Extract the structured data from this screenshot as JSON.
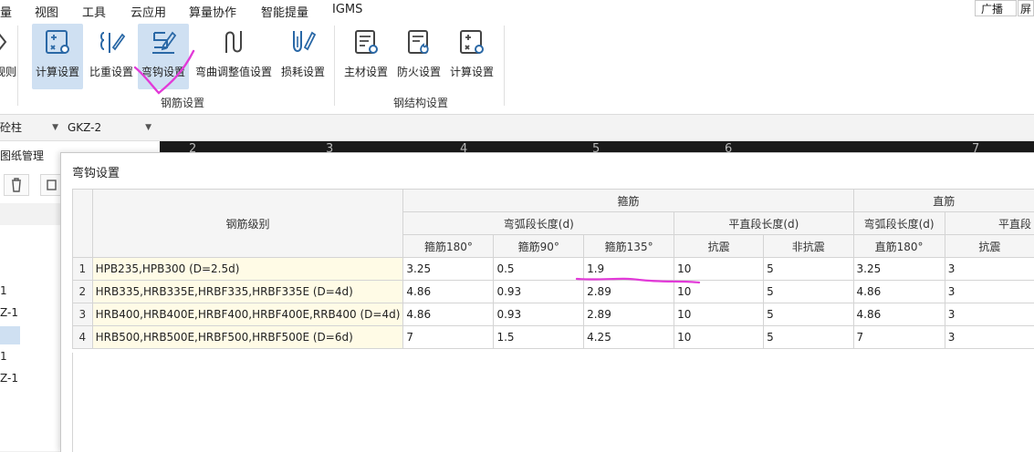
{
  "menubar": {
    "items": [
      "量",
      "视图",
      "工具",
      "云应用",
      "算量协作",
      "智能提量",
      "IGMS"
    ],
    "right_buttons": [
      "广播",
      "屏"
    ]
  },
  "ribbon": {
    "left_cut_label": "规则",
    "rebar_group": {
      "label": "钢筋设置",
      "buttons": [
        "计算设置",
        "比重设置",
        "弯钩设置",
        "弯曲调整值设置",
        "损耗设置"
      ]
    },
    "steel_group": {
      "label": "钢结构设置",
      "buttons": [
        "主材设置",
        "防火设置",
        "计算设置"
      ]
    }
  },
  "selectors": {
    "component_type": "砼柱",
    "component_name": "GKZ-2"
  },
  "left_panel": {
    "title": "图纸管理",
    "rows": [
      "1",
      "Z-1",
      "1",
      "Z-1"
    ]
  },
  "canvas": {
    "axis_numbers": [
      "2",
      "3",
      "4",
      "5",
      "6",
      "7"
    ]
  },
  "dialog": {
    "title": "弯钩设置",
    "headers": {
      "grade": "钢筋级别",
      "stirrup": "箍筋",
      "straight": "直筋",
      "arc_length": "弯弧段长度(d)",
      "flat_length": "平直段长度(d)",
      "straight_arc_length": "弯弧段长度(d)",
      "straight_flat_length": "平直段"
    },
    "subheaders": [
      "箍筋180°",
      "箍筋90°",
      "箍筋135°",
      "抗震",
      "非抗震",
      "直筋180°",
      "抗震"
    ],
    "rows": [
      {
        "idx": "1",
        "grade": "HPB235,HPB300 (D=2.5d)",
        "values": [
          "3.25",
          "0.5",
          "1.9",
          "10",
          "5",
          "3.25",
          "3"
        ]
      },
      {
        "idx": "2",
        "grade": "HRB335,HRB335E,HRBF335,HRBF335E (D=4d)",
        "values": [
          "4.86",
          "0.93",
          "2.89",
          "10",
          "5",
          "4.86",
          "3"
        ]
      },
      {
        "idx": "3",
        "grade": "HRB400,HRB400E,HRBF400,HRBF400E,RRB400 (D=4d)",
        "values": [
          "4.86",
          "0.93",
          "2.89",
          "10",
          "5",
          "4.86",
          "3"
        ]
      },
      {
        "idx": "4",
        "grade": "HRB500,HRB500E,HRBF500,HRBF500E (D=6d)",
        "values": [
          "7",
          "1.5",
          "4.25",
          "10",
          "5",
          "7",
          "3"
        ]
      }
    ]
  },
  "colors": {
    "annotation": "#e23ad8",
    "icon": "#2a68a6",
    "active_button": "#cfe0f2",
    "grade_cell": "#fffbe6"
  }
}
